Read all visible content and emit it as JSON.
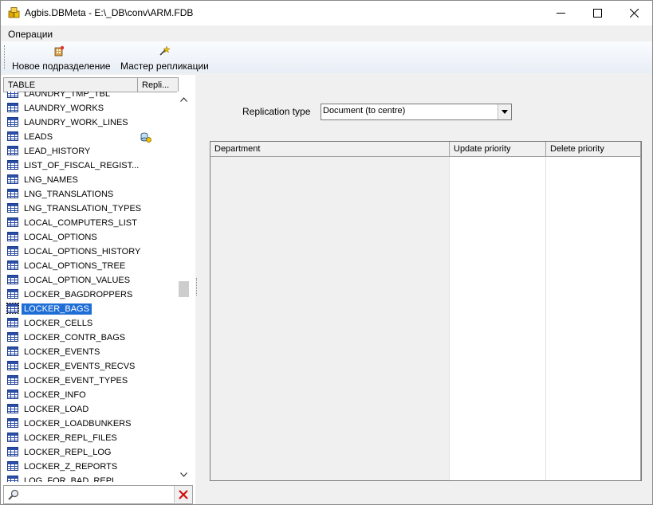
{
  "window": {
    "title": "Agbis.DBMeta - E:\\_DB\\conv\\ARM.FDB",
    "minimize_icon": "minimize-icon",
    "maximize_icon": "maximize-icon",
    "close_icon": "close-icon"
  },
  "menu": {
    "operations": "Операции"
  },
  "toolbar": {
    "new_department": "Новое подразделение",
    "replication_wizard": "Мастер репликации"
  },
  "table_grid": {
    "col_table": "TABLE",
    "col_repl": "Repli...",
    "rows": [
      {
        "name": "LAUNDRY_TMP_TBL",
        "replicated": false
      },
      {
        "name": "LAUNDRY_WORKS",
        "replicated": false
      },
      {
        "name": "LAUNDRY_WORK_LINES",
        "replicated": false
      },
      {
        "name": "LEADS",
        "replicated": true
      },
      {
        "name": "LEAD_HISTORY",
        "replicated": false
      },
      {
        "name": "LIST_OF_FISCAL_REGIST...",
        "replicated": false
      },
      {
        "name": "LNG_NAMES",
        "replicated": false
      },
      {
        "name": "LNG_TRANSLATIONS",
        "replicated": false
      },
      {
        "name": "LNG_TRANSLATION_TYPES",
        "replicated": false
      },
      {
        "name": "LOCAL_COMPUTERS_LIST",
        "replicated": false
      },
      {
        "name": "LOCAL_OPTIONS",
        "replicated": false
      },
      {
        "name": "LOCAL_OPTIONS_HISTORY",
        "replicated": false
      },
      {
        "name": "LOCAL_OPTIONS_TREE",
        "replicated": false
      },
      {
        "name": "LOCAL_OPTION_VALUES",
        "replicated": false
      },
      {
        "name": "LOCKER_BAGDROPPERS",
        "replicated": false
      },
      {
        "name": "LOCKER_BAGS",
        "replicated": false,
        "selected": true
      },
      {
        "name": "LOCKER_CELLS",
        "replicated": false
      },
      {
        "name": "LOCKER_CONTR_BAGS",
        "replicated": false
      },
      {
        "name": "LOCKER_EVENTS",
        "replicated": false
      },
      {
        "name": "LOCKER_EVENTS_RECVS",
        "replicated": false
      },
      {
        "name": "LOCKER_EVENT_TYPES",
        "replicated": false
      },
      {
        "name": "LOCKER_INFO",
        "replicated": false
      },
      {
        "name": "LOCKER_LOAD",
        "replicated": false
      },
      {
        "name": "LOCKER_LOADBUNKERS",
        "replicated": false
      },
      {
        "name": "LOCKER_REPL_FILES",
        "replicated": false
      },
      {
        "name": "LOCKER_REPL_LOG",
        "replicated": false
      },
      {
        "name": "LOCKER_Z_REPORTS",
        "replicated": false
      },
      {
        "name": "LOG_FOR_BAD_REPL",
        "replicated": false
      }
    ]
  },
  "search": {
    "value": "",
    "placeholder": ""
  },
  "replication": {
    "type_label": "Replication type",
    "type_value": "Document (to centre)"
  },
  "department_grid": {
    "col_department": "Department",
    "col_update": "Update priority",
    "col_delete": "Delete priority"
  },
  "colors": {
    "selection": "#1f6ed6",
    "table_icon": "#2b4fa8"
  }
}
